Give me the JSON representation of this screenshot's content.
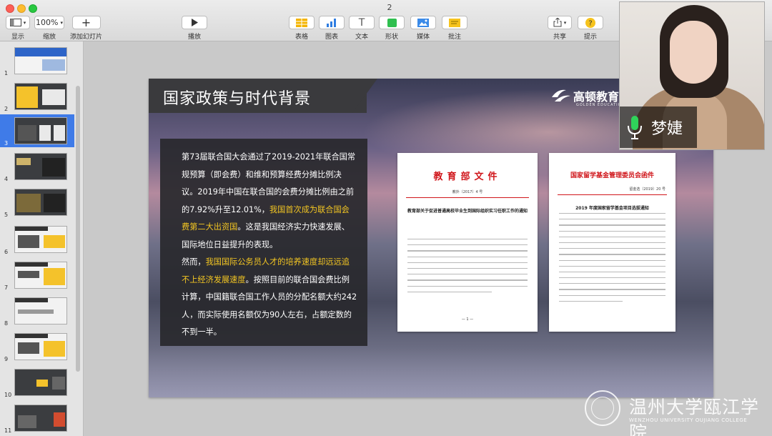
{
  "window": {
    "title": "2",
    "colors": {
      "close": "#fc5f57",
      "minimize": "#fdbc2e",
      "zoom": "#28c840"
    }
  },
  "toolbar": {
    "view_label": "显示",
    "zoom_value": "100%",
    "zoom_label": "缩放",
    "add_slide_label": "添加幻灯片",
    "play_label": "播放",
    "table_label": "表格",
    "chart_label": "图表",
    "text_label": "文本",
    "shape_label": "形状",
    "media_label": "媒体",
    "comment_label": "批注",
    "share_label": "共享",
    "tips_label": "提示",
    "icons": [
      "sidebar-view-icon",
      "chevron-down-icon",
      "plus-icon",
      "play-icon",
      "table-icon",
      "chart-icon",
      "text-icon",
      "shape-icon",
      "media-icon",
      "comment-icon",
      "share-icon",
      "question-icon"
    ]
  },
  "sidebar": {
    "selected": 3,
    "slides": [
      {
        "num": "1"
      },
      {
        "num": "2"
      },
      {
        "num": "3"
      },
      {
        "num": "4"
      },
      {
        "num": "5"
      },
      {
        "num": "6"
      },
      {
        "num": "7"
      },
      {
        "num": "8"
      },
      {
        "num": "9"
      },
      {
        "num": "10"
      },
      {
        "num": "11"
      }
    ]
  },
  "slide": {
    "title": "国家政策与时代背景",
    "logo_text": "高顿教育",
    "logo_sub": "GOLDEN EDUCATION",
    "paragraph1": {
      "t1": "第73届联合国大会通过了2019-2021年联合国常规预算（即会费）和维和预算经费分摊比例决议。2019年中国在联合国的会费分摊比例由之前的7.92%升至12.01%，",
      "h1": "我国首次成为联合国会费第二大出资国",
      "t2": "。这是我国经济实力快速发展、国际地位日益提升的表现。"
    },
    "paragraph2": {
      "t1": "然而，",
      "h1": "我国国际公务员人才的培养速度却远远追不上经济发展速度",
      "t2": "。按照目前的联合国会费比例计算，中国籍联合国工作人员的分配名额大约242人，而实际使用名额仅为90人左右，占额定数的不到一半。"
    },
    "doc1": {
      "header": "教育部文件",
      "number": "教外〔2017〕4 号",
      "subject": "教育部关于促进普通高校毕业生到国际组织实习任职工作的通知",
      "page": "— 1 —"
    },
    "doc2": {
      "header": "国家留学基金管理委员会函件",
      "number": "留金选〔2019〕20 号",
      "subject": "2019 年度国家留学基金项目选拔通知"
    },
    "accent_color": "#f3c622"
  },
  "webcam": {
    "name": "梦婕"
  },
  "watermark": {
    "name": "温州大学瓯江学院",
    "sub": "WENZHOU UNIVERSITY OUJIANG COLLEGE"
  }
}
